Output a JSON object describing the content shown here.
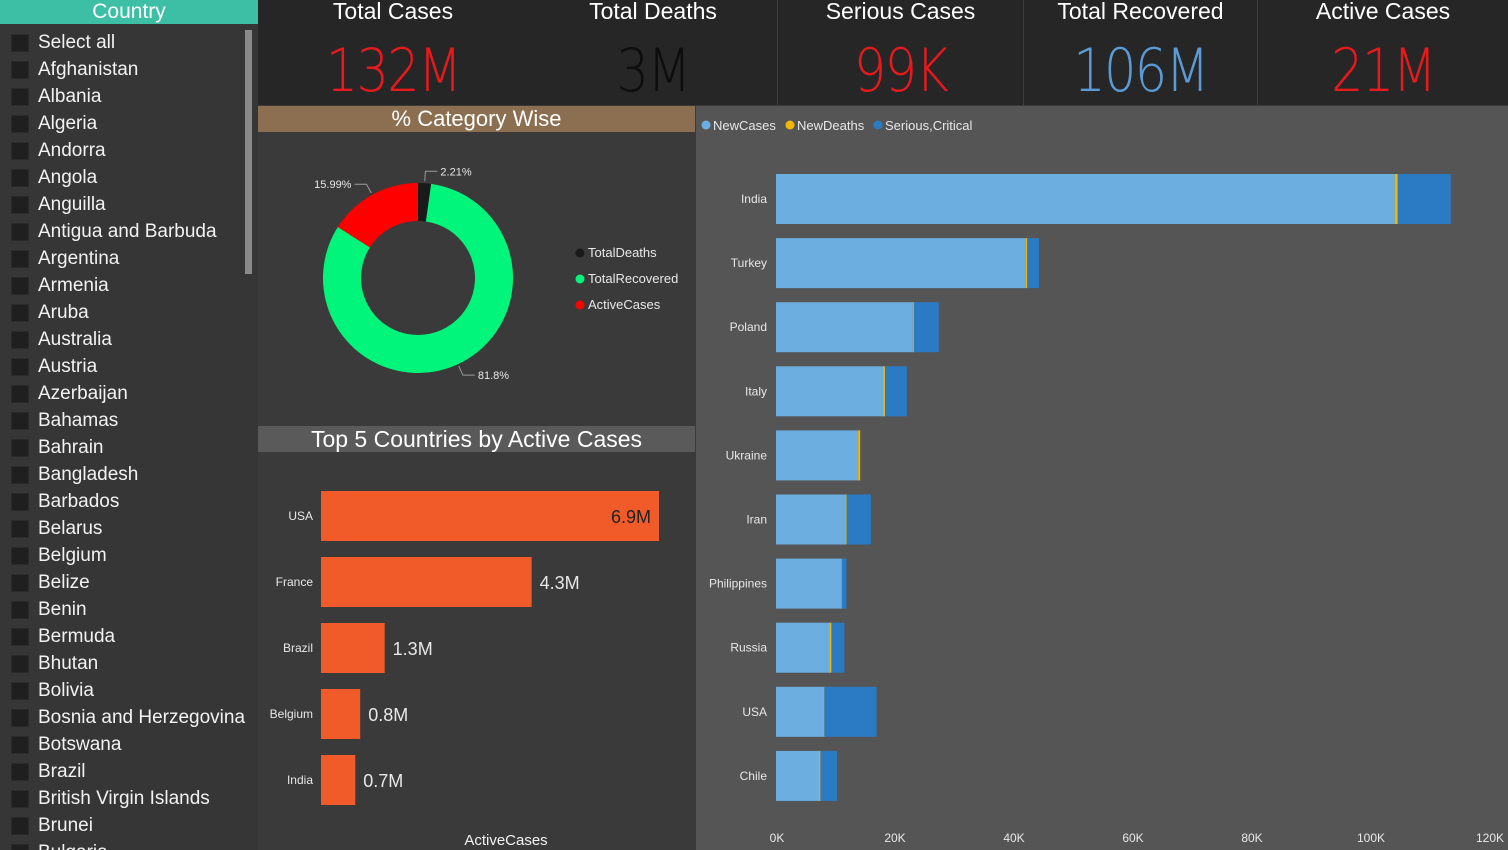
{
  "sidebar": {
    "header": "Country",
    "items": [
      "Select all",
      "Afghanistan",
      "Albania",
      "Algeria",
      "Andorra",
      "Angola",
      "Anguilla",
      "Antigua and Barbuda",
      "Argentina",
      "Armenia",
      "Aruba",
      "Australia",
      "Austria",
      "Azerbaijan",
      "Bahamas",
      "Bahrain",
      "Bangladesh",
      "Barbados",
      "Belarus",
      "Belgium",
      "Belize",
      "Benin",
      "Bermuda",
      "Bhutan",
      "Bolivia",
      "Bosnia and Herzegovina",
      "Botswana",
      "Brazil",
      "British Virgin Islands",
      "Brunei",
      "Bulgaria"
    ]
  },
  "kpis": [
    {
      "title": "Total Cases",
      "value": "132M",
      "color": "#e8191c"
    },
    {
      "title": "Total Deaths",
      "value": "3M",
      "color": "#0d0d0d"
    },
    {
      "title": "Serious Cases",
      "value": "99K",
      "color": "#e8191c"
    },
    {
      "title": "Total Recovered",
      "value": "106M",
      "color": "#5b9bd5"
    },
    {
      "title": "Active Cases",
      "value": "21M",
      "color": "#e8191c"
    }
  ],
  "donut": {
    "title": "% Category Wise",
    "legend_colors": [
      "#1a1a1a",
      "#00f57a",
      "#ff0000"
    ]
  },
  "top5": {
    "title": "Top 5 Countries by Active Cases",
    "bar_color": "#f15a29"
  },
  "stacked": {
    "colors": [
      "#6caee0",
      "#f2b705",
      "#2b7bc4"
    ]
  },
  "chart_data": [
    {
      "type": "pie",
      "title": "% Category Wise",
      "labels": [
        "TotalDeaths",
        "TotalRecovered",
        "ActiveCases"
      ],
      "values": [
        2.21,
        81.8,
        15.99
      ],
      "value_labels": [
        "2.21%",
        "81.8%",
        "15.99%"
      ],
      "legend": "right"
    },
    {
      "type": "bar",
      "orientation": "horizontal",
      "title": "Top 5 Countries by Active Cases",
      "categories": [
        "USA",
        "France",
        "Brazil",
        "Belgium",
        "India"
      ],
      "values": [
        6.9,
        4.3,
        1.3,
        0.8,
        0.7
      ],
      "data_labels": [
        "6.9M",
        "4.3M",
        "1.3M",
        "0.8M",
        "0.7M"
      ],
      "xlabel": "ActiveCases"
    },
    {
      "type": "bar",
      "orientation": "horizontal",
      "stacked": true,
      "categories": [
        "India",
        "Turkey",
        "Poland",
        "Italy",
        "Ukraine",
        "Iran",
        "Philippines",
        "Russia",
        "USA",
        "Chile"
      ],
      "series": [
        {
          "name": "NewCases",
          "values": [
            104000,
            42000,
            23000,
            18000,
            13800,
            11700,
            11000,
            9000,
            8000,
            7300
          ]
        },
        {
          "name": "NewDeaths",
          "values": [
            500,
            200,
            150,
            300,
            350,
            150,
            50,
            300,
            100,
            150
          ]
        },
        {
          "name": "Serious,Critical",
          "values": [
            8900,
            2000,
            4200,
            3700,
            0,
            4100,
            800,
            2200,
            8800,
            2800
          ]
        }
      ],
      "xlim": [
        0,
        120000
      ],
      "x_ticks": [
        "0K",
        "20K",
        "40K",
        "60K",
        "80K",
        "100K",
        "120K"
      ],
      "legend": "top-left"
    }
  ]
}
